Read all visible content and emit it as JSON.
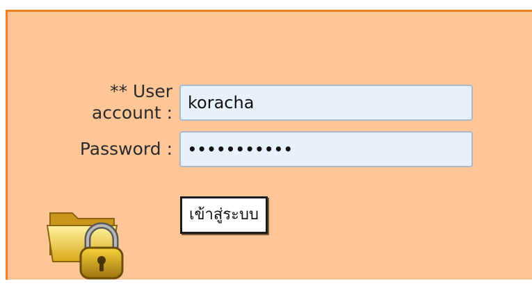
{
  "login": {
    "user_label_line1": "** User",
    "user_label_line2": "account :",
    "password_label": "Password :",
    "username_value": "koracha",
    "password_masked": "•••••••••••",
    "submit_label": "เข้าสู่ระบบ"
  },
  "icons": {
    "lock": "folder-lock-icon"
  },
  "colors": {
    "panel_background": "#fec697",
    "panel_border": "#f0801f",
    "input_background": "#e8f0fb"
  }
}
